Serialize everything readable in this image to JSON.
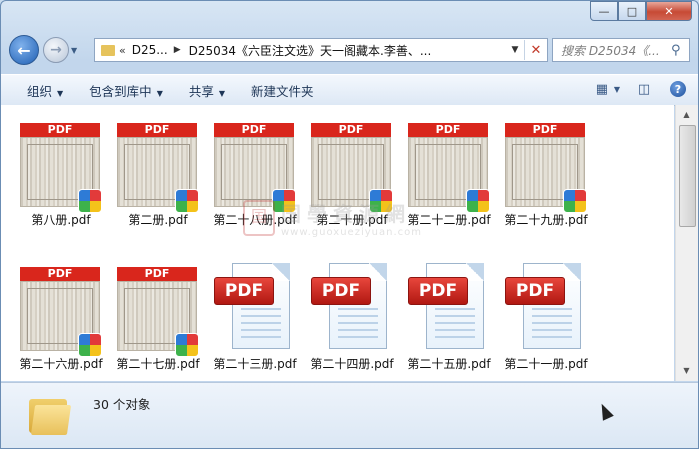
{
  "window": {
    "minimize_glyph": "—",
    "maximize_glyph": "□",
    "close_glyph": "✕"
  },
  "address": {
    "chevron": "«",
    "short_segment": "D25...",
    "path": "D25034《六臣注文选》天一阁藏本.李善、...",
    "clear_glyph": "✕"
  },
  "search": {
    "placeholder": "搜索 D25034《..."
  },
  "toolbar": {
    "organize": "组织",
    "include_in_library": "包含到库中",
    "share": "共享",
    "new_folder": "新建文件夹",
    "help_glyph": "?"
  },
  "files": [
    {
      "name": "第八册.pdf",
      "thumb": "scan"
    },
    {
      "name": "第二册.pdf",
      "thumb": "scan"
    },
    {
      "name": "第二十八册.pdf",
      "thumb": "scan"
    },
    {
      "name": "第二十册.pdf",
      "thumb": "scan"
    },
    {
      "name": "第二十二册.pdf",
      "thumb": "scan"
    },
    {
      "name": "第二十九册.pdf",
      "thumb": "scan"
    },
    {
      "name": "第二十六册.pdf",
      "thumb": "scan"
    },
    {
      "name": "第二十七册.pdf",
      "thumb": "scan"
    },
    {
      "name": "第二十三册.pdf",
      "thumb": "icon"
    },
    {
      "name": "第二十四册.pdf",
      "thumb": "icon"
    },
    {
      "name": "第二十五册.pdf",
      "thumb": "icon"
    },
    {
      "name": "第二十一册.pdf",
      "thumb": "icon"
    }
  ],
  "thumb_header": "PDF",
  "watermark": {
    "seal": "国",
    "title": "国學資源網",
    "url": "www.guoxueziyuan.com"
  },
  "status": {
    "count_text": "30 个对象"
  }
}
